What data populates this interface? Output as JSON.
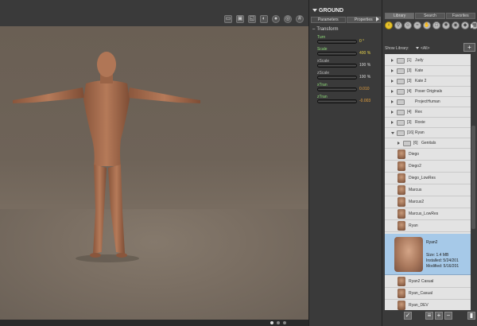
{
  "viewport": {
    "tools": [
      {
        "icon": "camera-select-icon",
        "glyph": "▭"
      },
      {
        "icon": "layout-icon",
        "glyph": "▣"
      },
      {
        "icon": "fit-icon",
        "glyph": "◱"
      },
      {
        "icon": "view-icon",
        "glyph": "◐"
      },
      {
        "icon": "sphere-icon",
        "glyph": "●"
      },
      {
        "icon": "target-icon",
        "glyph": "◎"
      },
      {
        "icon": "grid-icon",
        "glyph": "#"
      }
    ]
  },
  "params": {
    "title": "GROUND",
    "tabs": [
      "Parameters",
      "Properties"
    ],
    "section": "Transform",
    "dials": [
      {
        "label": "Turn",
        "value": "0 °",
        "label_color": "green",
        "value_color": "yellow"
      },
      {
        "label": "Scale",
        "value": "400 %",
        "label_color": "green",
        "value_color": "yellow"
      },
      {
        "label": "xScale",
        "value": "100 %",
        "label_color": "",
        "value_color": "white"
      },
      {
        "label": "zScale",
        "value": "100 %",
        "label_color": "",
        "value_color": "white"
      },
      {
        "label": "xTran",
        "value": "0.010",
        "label_color": "green",
        "value_color": "orange"
      },
      {
        "label": "zTran",
        "value": "-0.003",
        "label_color": "green",
        "value_color": "orange"
      }
    ]
  },
  "library": {
    "tabs": [
      "Library",
      "Search",
      "Favorites"
    ],
    "icons": [
      {
        "name": "figures-icon",
        "glyph": "♀"
      },
      {
        "name": "pose-icon",
        "glyph": "⚲"
      },
      {
        "name": "expression-icon",
        "glyph": "☺"
      },
      {
        "name": "hair-icon",
        "glyph": "≈"
      },
      {
        "name": "hand-icon",
        "glyph": "✋"
      },
      {
        "name": "props-icon",
        "glyph": "□"
      },
      {
        "name": "lights-icon",
        "glyph": "✺"
      },
      {
        "name": "camera-icon",
        "glyph": "◉"
      },
      {
        "name": "materials-icon",
        "glyph": "◆"
      },
      {
        "name": "scene-icon",
        "glyph": "▦"
      }
    ],
    "show_label": "Show Library:",
    "show_value": "<All>",
    "folders": [
      {
        "count": "[1]",
        "name": "Judy"
      },
      {
        "count": "[3]",
        "name": "Kate"
      },
      {
        "count": "[3]",
        "name": "Kate 2"
      },
      {
        "count": "[4]",
        "name": "Poser Originals"
      },
      {
        "count": "",
        "name": "ProjectHuman"
      },
      {
        "count": "[4]",
        "name": "Rex"
      },
      {
        "count": "[3]",
        "name": "Roxie"
      }
    ],
    "expanded_folder": {
      "count": "[16]",
      "name": "Ryan"
    },
    "subfolder": {
      "count": "[6]",
      "name": "Genitals"
    },
    "figures_top": [
      "Diego",
      "Diego2",
      "Diego_LowRes",
      "Marcus",
      "Marcus2",
      "Marcus_LowRes",
      "Ryan"
    ],
    "selected": {
      "name": "Ryan2",
      "size": "Size: 1.4 MB",
      "installed": "Installed: 5/24/201",
      "modified": "Modified: 5/16/201"
    },
    "figures_bottom": [
      "Ryan2 Casual",
      "Ryan_Casual",
      "Ryan_DEV"
    ]
  }
}
